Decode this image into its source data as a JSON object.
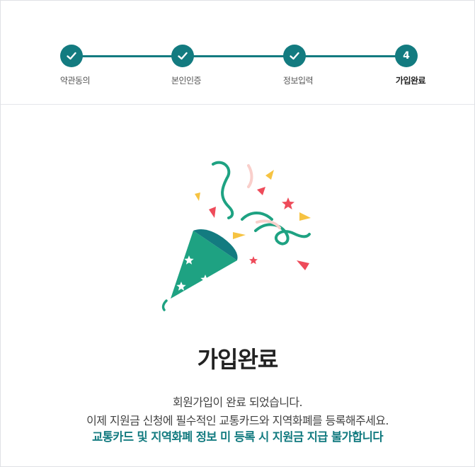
{
  "stepper": {
    "steps": [
      {
        "label": "약관동의",
        "status": "done"
      },
      {
        "label": "본인인증",
        "status": "done"
      },
      {
        "label": "정보입력",
        "status": "done"
      },
      {
        "label": "가입완료",
        "number": "4",
        "status": "current"
      }
    ]
  },
  "icons": {
    "step_done": "check-icon",
    "illustration": "party-popper-icon"
  },
  "colors": {
    "accent": "#137b80",
    "popper_green": "#1ea282",
    "confetti_yellow": "#f6c342",
    "confetti_red": "#ee4b5a",
    "confetti_pink": "#f9cfcb"
  },
  "main": {
    "title": "가입완료",
    "message_line1": "회원가입이 완료 되었습니다.",
    "message_line2": "이제 지원금 신청에 필수적인 교통카드와 지역화폐를 등록해주세요.",
    "notice": "교통카드 및 지역화폐 정보 미 등록 시 지원금 지급 불가합니다"
  }
}
